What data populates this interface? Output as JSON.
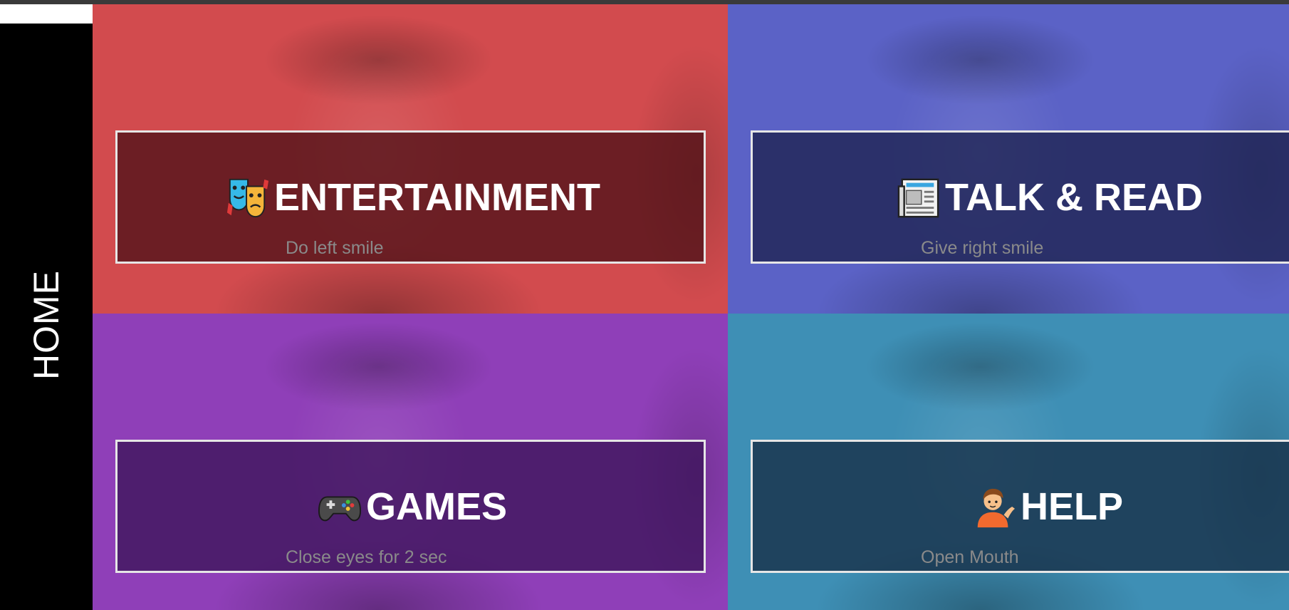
{
  "sidebar": {
    "label": "HOME"
  },
  "tiles": [
    {
      "title": "ENTERTAINMENT",
      "subtitle": "Do left smile",
      "icon": "performing-arts-icon",
      "color": "#d24b4e"
    },
    {
      "title": "TALK & READ",
      "subtitle": "Give right smile",
      "icon": "newspaper-icon",
      "color": "#5b62c6"
    },
    {
      "title": "GAMES",
      "subtitle": "Close eyes for 2 sec",
      "icon": "game-controller-icon",
      "color": "#8f3fb8"
    },
    {
      "title": "HELP",
      "subtitle": "Open Mouth",
      "icon": "raising-hand-person-icon",
      "color": "#3e8fb5"
    }
  ]
}
